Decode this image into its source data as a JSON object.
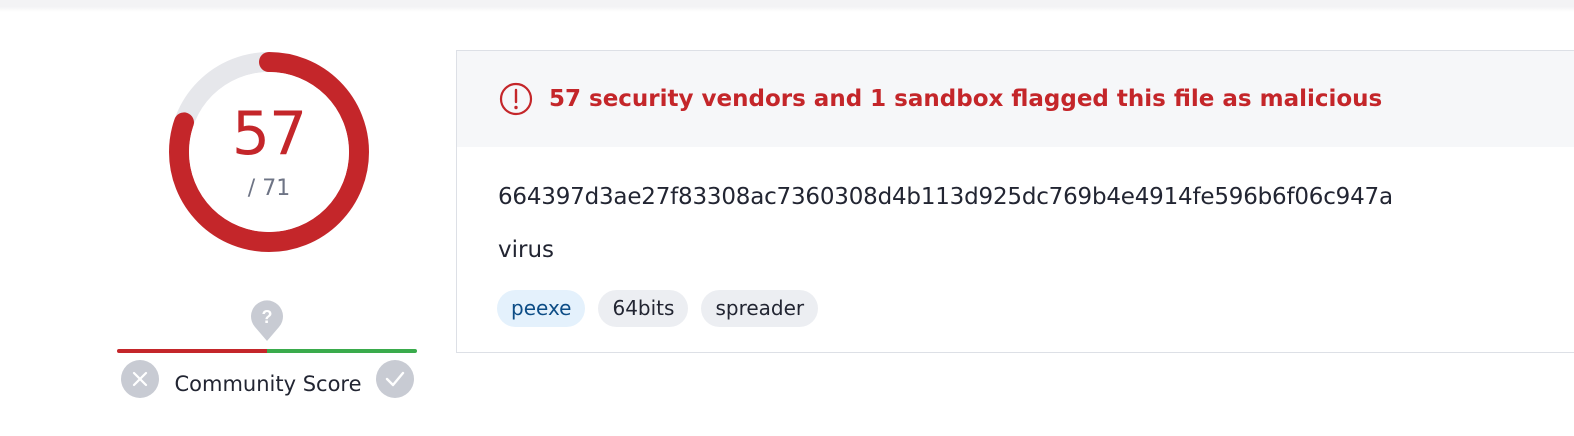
{
  "detection": {
    "malicious_count": "57",
    "total": "/ 71",
    "malicious_ratio": 0.803,
    "accent_color": "#c4262a"
  },
  "community": {
    "label": "Community Score",
    "negative_fraction": 0.5,
    "icons": [
      "question-pin-icon",
      "close-icon",
      "checkmark-icon"
    ],
    "colors": {
      "negative": "#c4262a",
      "positive": "#3aab4c"
    }
  },
  "alert": {
    "icon": "exclamation-circle-icon",
    "text": "57 security vendors and 1 sandbox flagged this file as malicious"
  },
  "file": {
    "hash": "664397d3ae27f83308ac7360308d4b113d925dc769b4e4914fe596b6f06c947a",
    "name": "virus"
  },
  "tags": [
    {
      "label": "peexe",
      "highlighted": true
    },
    {
      "label": "64bits",
      "highlighted": false
    },
    {
      "label": "spreader",
      "highlighted": false
    }
  ]
}
